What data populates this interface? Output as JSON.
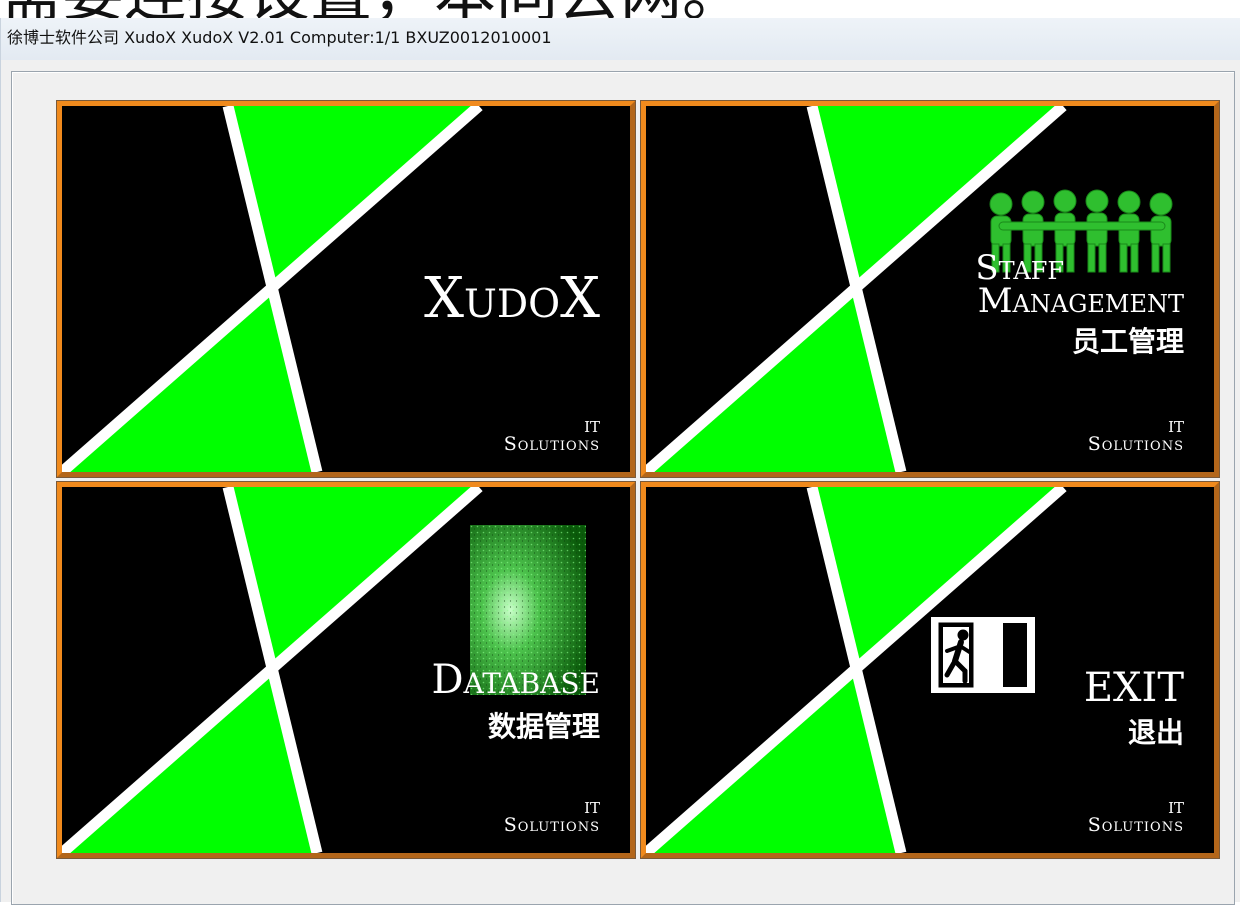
{
  "background_caption": "需要连接设置，本同去网。",
  "window": {
    "title": "徐博士软件公司  XudoX  XudoX V2.01 Computer:1/1 BXUZ0012010001"
  },
  "tiles": [
    {
      "title": "XudoX",
      "title_cn": "",
      "brand_line1": "IT",
      "brand_line2": "Solutions",
      "icon": "none"
    },
    {
      "title_line1": "Staff",
      "title_line2": "Management",
      "title_cn": "员工管理",
      "brand_line1": "IT",
      "brand_line2": "Solutions",
      "icon": "people-group-icon"
    },
    {
      "title": "Database",
      "title_cn": "数据管理",
      "brand_line1": "IT",
      "brand_line2": "Solutions",
      "icon": "green-data-stream-icon"
    },
    {
      "title": "EXIT",
      "title_cn": "退出",
      "brand_line1": "IT",
      "brand_line2": "Solutions",
      "icon": "exit-sign-icon"
    }
  ],
  "colors": {
    "tile_bg": "#000000",
    "stripe_green": "#00ff00",
    "border_orange": "#f08a1d",
    "window_bg": "#f0f0f0"
  }
}
